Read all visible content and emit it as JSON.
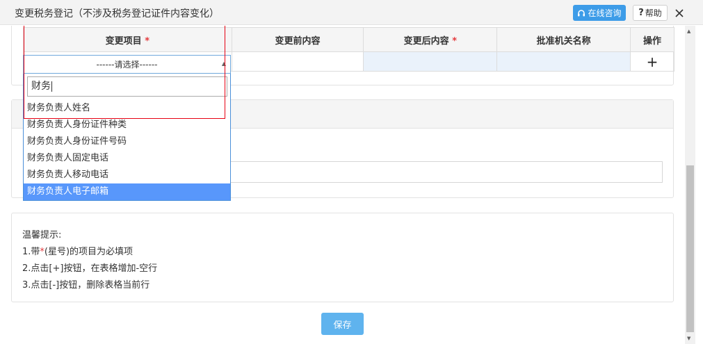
{
  "dialog": {
    "title": "变更税务登记（不涉及税务登记证件内容变化）",
    "consult_label": "在线咨询",
    "help_label": "帮助"
  },
  "table": {
    "headers": [
      "变更项目",
      "变更前内容",
      "变更后内容",
      "批准机关名称",
      "操作"
    ],
    "required_mark": "*",
    "add_row_symbol": "+"
  },
  "select": {
    "placeholder": "------请选择------"
  },
  "dropdown": {
    "search_value": "财务",
    "options": [
      "财务负责人姓名",
      "财务负责人身份证件种类",
      "财务负责人身份证件号码",
      "财务负责人固定电话",
      "财务负责人移动电话",
      "财务负责人电子邮箱"
    ],
    "highlighted_index": 5
  },
  "tips": {
    "heading": "温馨提示:",
    "line1_prefix": "1.带",
    "line1_star": "*",
    "line1_suffix": "(星号)的项目为必填项",
    "line2": "2.点击[+]按钮，在表格增加-空行",
    "line3": "3.点击[-]按钮，删除表格当前行"
  },
  "save_label": "保存",
  "colors": {
    "primary": "#3d9ce8",
    "required": "#e4393c",
    "highlight": "#5897fb",
    "annotation": "#e60012"
  }
}
